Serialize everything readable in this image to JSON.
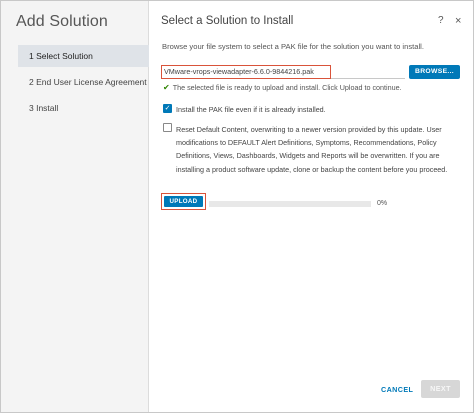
{
  "dialog": {
    "title": "Add Solution",
    "steps": [
      {
        "label": "1 Select Solution",
        "active": true
      },
      {
        "label": "2 End User License Agreement",
        "active": false
      },
      {
        "label": "3 Install",
        "active": false
      }
    ]
  },
  "main": {
    "title": "Select a Solution to Install",
    "help_icon": "?",
    "close_icon": "×",
    "browse_instruction": "Browse your file system to select a PAK file for the solution you want to install.",
    "file_input": {
      "value": "VMware-vrops-viewadapter-6.6.0-9844216.pak"
    },
    "browse_label": "BROWSE...",
    "validation_icon": "✔",
    "validation_text": "The selected file is ready to upload and install. Click Upload to continue.",
    "options": [
      {
        "label": "Install the PAK file even if it is already installed.",
        "checked": true
      },
      {
        "label": "Reset Default Content, overwriting to a newer version provided by this update. User modifications to DEFAULT Alert Definitions, Symptoms, Recommendations, Policy Definitions, Views, Dashboards, Widgets and Reports will be overwritten. If you are installing a product software update, clone or backup the content before you proceed.",
        "checked": false
      }
    ],
    "upload_label": "UPLOAD",
    "progress": {
      "percent": 0,
      "text": "0%"
    }
  },
  "footer": {
    "cancel_label": "CANCEL",
    "next_label": "NEXT"
  },
  "colors": {
    "accent": "#0079b8",
    "highlight_border": "#d9533a",
    "success": "#2f8400"
  }
}
